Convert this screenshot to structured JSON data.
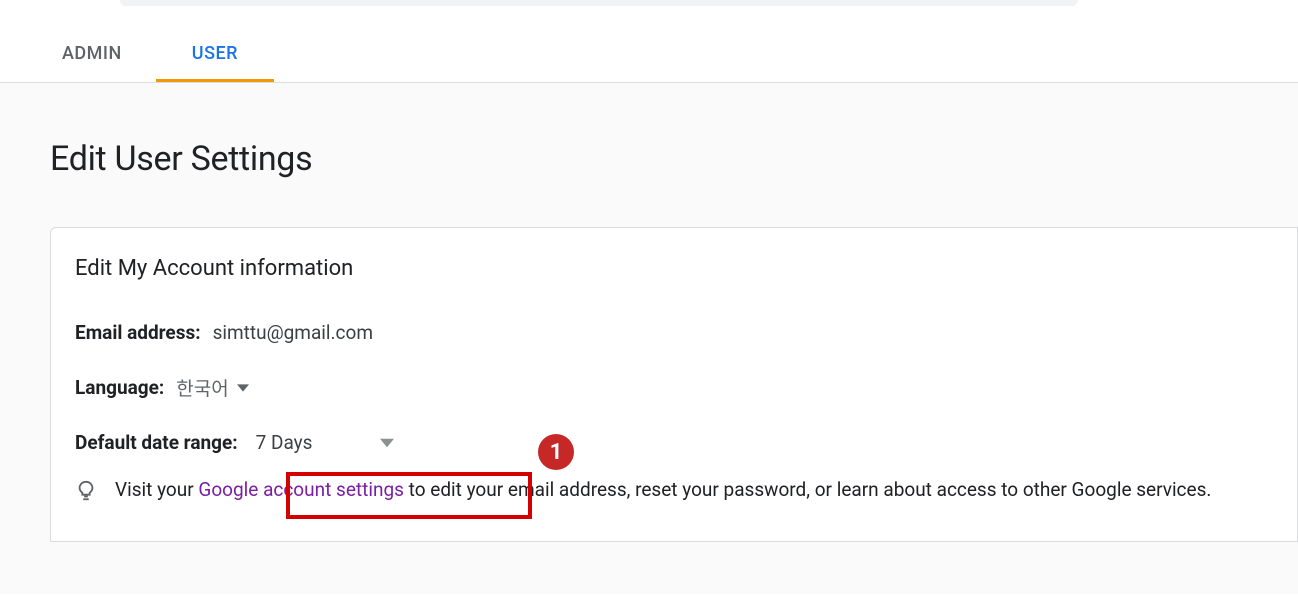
{
  "tabs": {
    "admin": "ADMIN",
    "user": "USER"
  },
  "page": {
    "title": "Edit User Settings"
  },
  "card": {
    "title": "Edit My Account information",
    "email_label": "Email address:",
    "email_value": "simttu@gmail.com",
    "language_label": "Language:",
    "language_value": "한국어",
    "date_range_label": "Default date range:",
    "date_range_value": "7 Days",
    "tip_prefix": "Visit your ",
    "tip_link": "Google account settings",
    "tip_suffix": " to edit your email address, reset your password, or learn about access to other Google services."
  },
  "annotation": {
    "badge": "1"
  }
}
